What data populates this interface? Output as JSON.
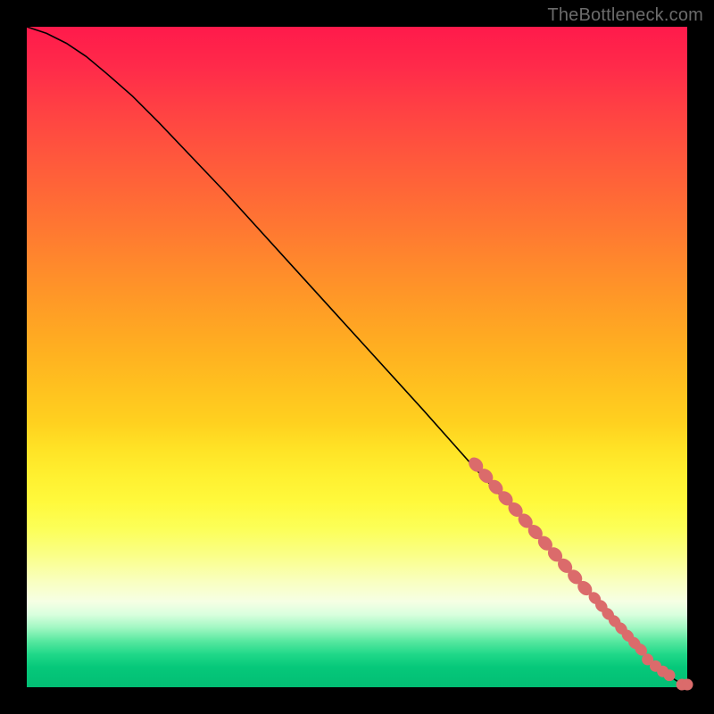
{
  "watermark": "TheBottleneck.com",
  "colors": {
    "point_fill": "#db6b6b",
    "curve_stroke": "#000000",
    "frame_bg": "#000000"
  },
  "chart_data": {
    "type": "line",
    "title": "",
    "xlabel": "",
    "ylabel": "",
    "xlim": [
      0,
      100
    ],
    "ylim": [
      0,
      100
    ],
    "grid": false,
    "series": [
      {
        "name": "curve",
        "kind": "line",
        "x": [
          0,
          3,
          6,
          9,
          12,
          16,
          20,
          30,
          40,
          50,
          60,
          68,
          76,
          82,
          86,
          89,
          91,
          93,
          94.5,
          96,
          97.2,
          98.2,
          99,
          100
        ],
        "y": [
          100,
          99,
          97.5,
          95.5,
          93,
          89.5,
          85.5,
          75,
          64,
          53,
          42,
          33,
          24.5,
          18,
          13.5,
          10,
          7.5,
          5.5,
          4,
          2.7,
          1.8,
          1.1,
          0.6,
          0.4
        ]
      },
      {
        "name": "cluster-upper",
        "kind": "scatter",
        "x": [
          68,
          69.5,
          71,
          72.5,
          74,
          75.5,
          77,
          78.5,
          80,
          81.5,
          83,
          84.5
        ],
        "y": [
          33.7,
          32,
          30.3,
          28.6,
          26.9,
          25.2,
          23.5,
          21.8,
          20.1,
          18.4,
          16.7,
          15
        ]
      },
      {
        "name": "cluster-diag",
        "kind": "scatter",
        "x": [
          86,
          87,
          88,
          89,
          90,
          91,
          92,
          93
        ],
        "y": [
          13.5,
          12.3,
          11.1,
          10,
          8.9,
          7.8,
          6.7,
          5.7
        ]
      },
      {
        "name": "cluster-lower",
        "kind": "scatter",
        "x": [
          94,
          95.2,
          96.3,
          97.3
        ],
        "y": [
          4.2,
          3.2,
          2.4,
          1.8
        ]
      },
      {
        "name": "tail",
        "kind": "scatter",
        "x": [
          99.2,
          100
        ],
        "y": [
          0.4,
          0.4
        ]
      }
    ],
    "background_gradient": {
      "direction": "top-to-bottom",
      "stops": [
        {
          "pos": 0.0,
          "color": "#ff1a4b"
        },
        {
          "pos": 0.25,
          "color": "#ff6a36"
        },
        {
          "pos": 0.5,
          "color": "#ffb022"
        },
        {
          "pos": 0.7,
          "color": "#fff635"
        },
        {
          "pos": 0.85,
          "color": "#f8ffcf"
        },
        {
          "pos": 0.93,
          "color": "#5ee9a2"
        },
        {
          "pos": 1.0,
          "color": "#02be74"
        }
      ]
    }
  }
}
